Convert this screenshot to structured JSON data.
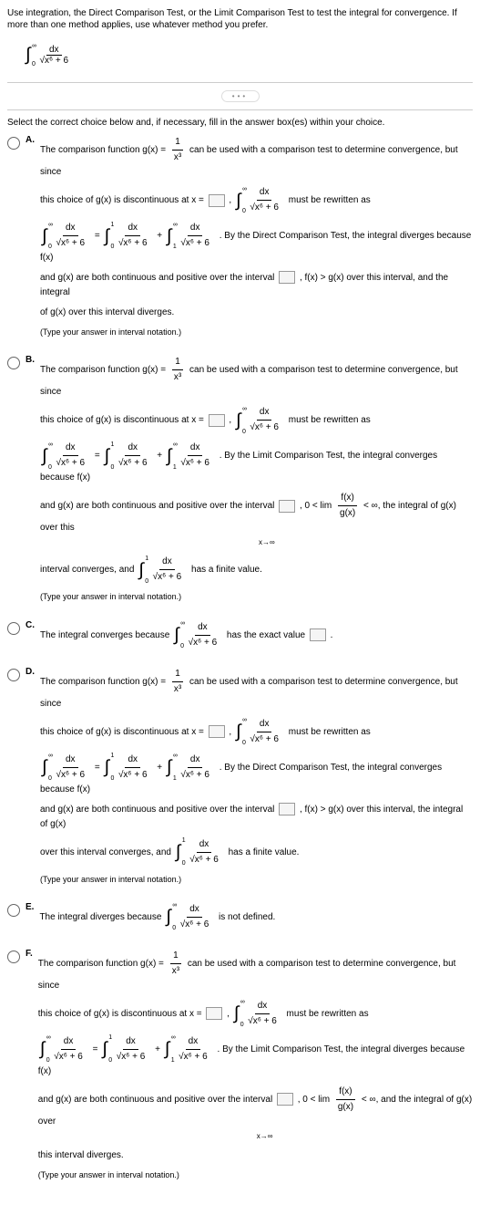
{
  "question": "Use integration, the Direct Comparison Test, or the Limit Comparison Test to test the integral for convergence. If more than one method applies, use whatever method you prefer.",
  "main_integral": {
    "num": "dx",
    "den": "√x⁶ + 6",
    "lower": "0",
    "upper": "∞"
  },
  "select_text": "Select the correct choice below and, if necessary, fill in the answer box(es) within your choice.",
  "g_comparison": "The comparison function g(x) =",
  "g_frac": {
    "num": "1",
    "den": "x³"
  },
  "g_tail": "can be used with a comparison test to determine convergence, but since",
  "discont": "this choice of g(x) is discontinuous at x =",
  "rewrite_tail": "must be rewritten as",
  "split_integral": "=",
  "plus": "+",
  "dct_diverge": ". By the Direct Comparison Test, the integral diverges because f(x)",
  "dct_converge": ". By the Direct Comparison Test, the integral converges because f(x)",
  "lct_converge": ". By the Limit Comparison Test, the integral converges because f(x)",
  "lct_diverge": ". By the Limit Comparison Test, the integral diverges because f(x)",
  "both_cont": "and g(x) are both continuous and positive over the interval",
  "fx_gt": ", f(x) > g(x) over this interval, and the integral",
  "fx_gt_gx_int": ", f(x) > g(x) over this interval, the integral of g(x)",
  "of_gx_div": "of g(x) over this interval diverges.",
  "lim_label": ", 0 < lim",
  "lim_sub": "x→∞",
  "lim_frac": "f(x)",
  "lim_frac_den": "g(x)",
  "lim_tail_conv": "< ∞, the integral of g(x) over this",
  "lim_tail_div": "< ∞, and the integral of g(x) over",
  "interval_conv": "interval converges, and",
  "over_interval_conv": "over this interval converges, and",
  "finite": "has a finite value.",
  "this_div": "this interval diverges.",
  "type_note": "(Type your answer in interval notation.)",
  "c_text": "The integral converges because",
  "c_tail": "has the exact value",
  "e_text": "The integral diverges because",
  "e_tail": "is not defined.",
  "period": ".",
  "labels": {
    "A": "A.",
    "B": "B.",
    "C": "C.",
    "D": "D.",
    "E": "E.",
    "F": "F."
  }
}
